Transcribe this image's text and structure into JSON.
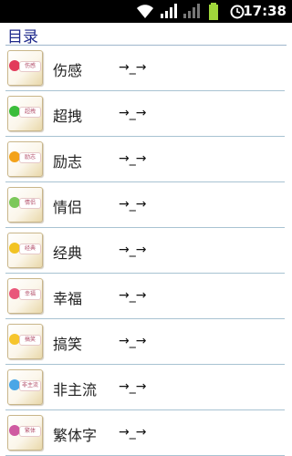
{
  "status": {
    "time": "17:38",
    "icons": [
      "wifi-icon",
      "signal-icon",
      "signal-icon",
      "battery-icon",
      "alarm-icon"
    ]
  },
  "header": {
    "title": "目录"
  },
  "items": [
    {
      "label": "伤感",
      "tag": "伤感",
      "color": "#e23a5a"
    },
    {
      "label": "超拽",
      "tag": "超拽",
      "color": "#3bbd3a"
    },
    {
      "label": "励志",
      "tag": "励志",
      "color": "#f3a21a"
    },
    {
      "label": "情侣",
      "tag": "情侣",
      "color": "#7cc85a"
    },
    {
      "label": "经典",
      "tag": "经典",
      "color": "#f2c323"
    },
    {
      "label": "幸福",
      "tag": "幸福",
      "color": "#e9577a"
    },
    {
      "label": "搞笑",
      "tag": "搞笑",
      "color": "#f6c52d"
    },
    {
      "label": "非主流",
      "tag": "非主流",
      "color": "#4aa6e6"
    },
    {
      "label": "繁体字",
      "tag": "繁体",
      "color": "#cf5aa0"
    }
  ],
  "arrow_text": "→_→"
}
